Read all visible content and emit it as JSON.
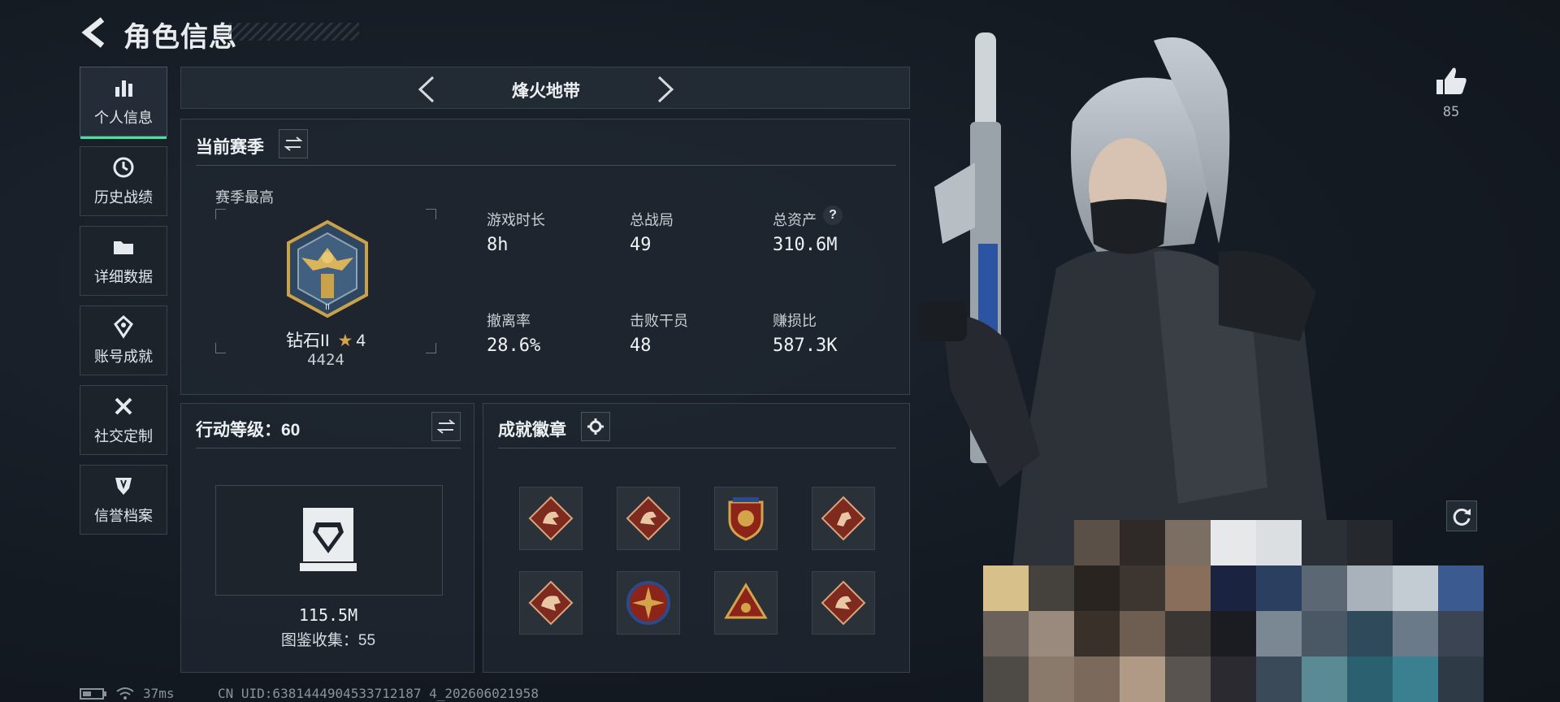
{
  "header": {
    "title": "角色信息"
  },
  "sidebar": {
    "items": [
      {
        "label": "个人信息",
        "icon": "bar-chart-icon",
        "active": true
      },
      {
        "label": "历史战绩",
        "icon": "history-clock-icon"
      },
      {
        "label": "详细数据",
        "icon": "folder-icon"
      },
      {
        "label": "账号成就",
        "icon": "trophy-emblem-icon"
      },
      {
        "label": "社交定制",
        "icon": "tools-icon"
      },
      {
        "label": "信誉档案",
        "icon": "shield-badge-icon"
      }
    ]
  },
  "mode_selector": {
    "label": "烽火地带"
  },
  "season": {
    "title": "当前赛季",
    "best_label": "赛季最高",
    "rank_name": "钻石II",
    "rank_stars": "4",
    "rank_points": "4424",
    "stats": [
      {
        "label": "游戏时长",
        "value": "8h"
      },
      {
        "label": "总战局",
        "value": "49"
      },
      {
        "label": "总资产",
        "value": "310.6M",
        "help": "?"
      },
      {
        "label": "撤离率",
        "value": "28.6%"
      },
      {
        "label": "击败干员",
        "value": "48"
      },
      {
        "label": "赚损比",
        "value": "587.3K"
      }
    ]
  },
  "action_level": {
    "title": "行动等级：60",
    "value": "115.5M",
    "collection": "图鉴收集：55"
  },
  "achievements": {
    "title": "成就徽章",
    "badges": [
      "dragon-red-badge-icon",
      "dragon-red-badge-icon",
      "shield-gold-badge-icon",
      "runner-red-badge-icon",
      "dragon-red-badge-icon",
      "star-compass-badge-icon",
      "triangle-gold-badge-icon",
      "dragon-red-badge-icon"
    ]
  },
  "likes": {
    "count": "85"
  },
  "status_bar": {
    "ping": "37ms",
    "uid": "CN UID:6381444904533712187 4_202606021958"
  },
  "colors": {
    "accent_green": "#3fe59a",
    "badge_red": "#8a2a1e",
    "gold": "#d4a44a"
  }
}
